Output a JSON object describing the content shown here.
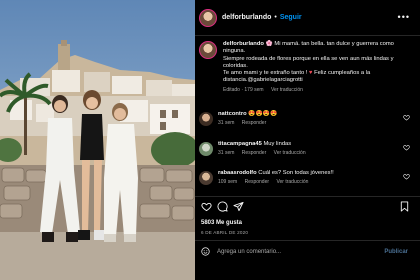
{
  "post": {
    "username": "delforburlando",
    "follow_label": "Seguir",
    "more_icon": "more-icon"
  },
  "caption": {
    "username": "delforburlando",
    "text_1": "Mi mamá. tan bella. tan dulce y guerrera como ninguna.",
    "text_2": "Siempre rodeada de flores porque en ella se ven aun más lindas y coloridas.",
    "text_3": "Te amo mami y te extraño tanto !",
    "text_4": "Feliz cumpleaños a la distancia.@gabrielagarciagrotti",
    "edited": "Editado · 179 sem",
    "view_translation": "Ver traducción"
  },
  "comments": [
    {
      "username": "nattcontro",
      "text": "😍😍😍😍",
      "time": "31 sem",
      "reply": "Responder"
    },
    {
      "username": "titacampagna45",
      "text": "Muy lindas",
      "time": "31 sem",
      "reply": "Responder",
      "translate": "Ver traducción"
    },
    {
      "username": "rabaasrodolfo",
      "text": "Cuál es? Son todas jóvenes!!",
      "time": "109 sem",
      "reply": "Responder",
      "translate": "Ver traducción"
    }
  ],
  "stats": {
    "likes": "5803 Me gusta",
    "date": "6 DE ABRIL DE 2020"
  },
  "add_comment": {
    "placeholder": "Agrega un comentario...",
    "publish_label": "Publicar"
  },
  "colors": {
    "accent": "#0095f6",
    "background": "#000000",
    "muted": "#a8a8a8",
    "like_red": "#ed4956"
  }
}
